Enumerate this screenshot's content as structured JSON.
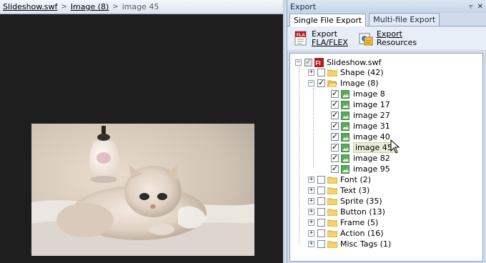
{
  "breadcrumb": {
    "root": "Slideshow.swf",
    "parent": "Image (8)",
    "current": "image 45"
  },
  "panel": {
    "title": "Export",
    "pin_icon": "pin-icon",
    "close_icon": "close-icon"
  },
  "tabs": [
    {
      "label": "Single File Export",
      "active": true
    },
    {
      "label": "Multi-file Export",
      "active": false
    }
  ],
  "toolbar": {
    "export_fla": {
      "line1": "Export",
      "line2": "FLA/FLEX"
    },
    "export_resources": {
      "line1": "Export",
      "line2": "Resources"
    }
  },
  "tree": {
    "root": {
      "label": "Slideshow.swf"
    },
    "shape": {
      "label": "Shape (42)"
    },
    "image": {
      "label": "Image (8)"
    },
    "images": [
      {
        "label": "image 8"
      },
      {
        "label": "image 17"
      },
      {
        "label": "image 27"
      },
      {
        "label": "image 31"
      },
      {
        "label": "image 40"
      },
      {
        "label": "image 45"
      },
      {
        "label": "image 82"
      },
      {
        "label": "image 95"
      }
    ],
    "others": [
      {
        "label": "Font (2)"
      },
      {
        "label": "Text (3)"
      },
      {
        "label": "Sprite (35)"
      },
      {
        "label": "Button (13)"
      },
      {
        "label": "Frame (5)"
      },
      {
        "label": "Action (16)"
      },
      {
        "label": "Misc Tags (1)"
      }
    ]
  },
  "colors": {
    "panel_bg": "#cfdbea",
    "viewer_bg": "#1e1e1e",
    "selection": "#e8edd6"
  }
}
